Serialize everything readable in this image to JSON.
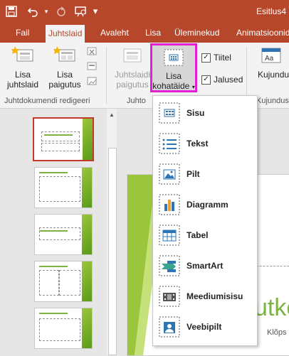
{
  "titlebar": {
    "app_title": "Esitlus4",
    "icons": [
      "save-icon",
      "undo-icon",
      "redo-icon",
      "present-icon"
    ]
  },
  "tabs": [
    {
      "label": "Fail",
      "active": false
    },
    {
      "label": "Juhtslaid",
      "active": true
    },
    {
      "label": "Avaleht",
      "active": false
    },
    {
      "label": "Lisa",
      "active": false
    },
    {
      "label": "Üleminekud",
      "active": false
    },
    {
      "label": "Animatsioonid",
      "active": false
    }
  ],
  "ribbon": {
    "insert_slide_master": "Lisa juhtslaid",
    "insert_layout": "Lisa paigutus",
    "master_layout": "Juhtslaidi paigutus",
    "insert_placeholder": "Lisa kohatäide",
    "title_checkbox": "Tiitel",
    "footers_checkbox": "Jalused",
    "themes": "Kujundus",
    "group_edit_master": "Juhtdokumendi redigeeri",
    "group_master_layout": "Juhto",
    "group_themes": "Kujunduse"
  },
  "placeholder_menu": {
    "items": [
      {
        "label": "Sisu",
        "icon": "content-placeholder-icon"
      },
      {
        "label": "Tekst",
        "icon": "text-placeholder-icon"
      },
      {
        "label": "Pilt",
        "icon": "picture-placeholder-icon"
      },
      {
        "label": "Diagramm",
        "icon": "chart-placeholder-icon"
      },
      {
        "label": "Tabel",
        "icon": "table-placeholder-icon"
      },
      {
        "label": "SmartArt",
        "icon": "smartart-placeholder-icon"
      },
      {
        "label": "Meediumisisu",
        "icon": "media-placeholder-icon"
      },
      {
        "label": "Veebipilt",
        "icon": "online-picture-placeholder-icon"
      }
    ]
  },
  "slide": {
    "title_fragment": "utke",
    "subtitle_fragment": "Klõps"
  },
  "colors": {
    "accent": "#b7472a",
    "highlight": "#e21fd2",
    "green": "#7cb342"
  }
}
